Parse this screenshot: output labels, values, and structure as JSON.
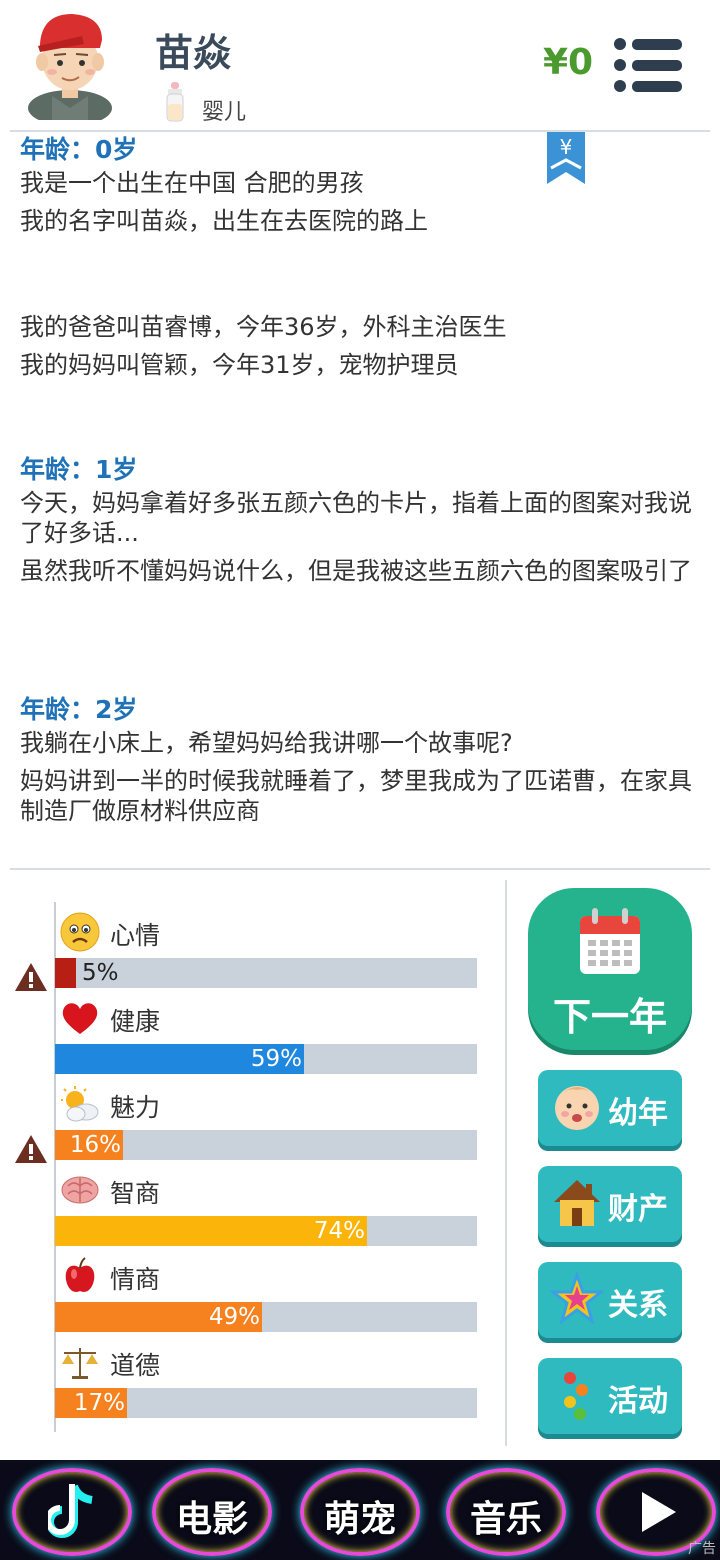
{
  "header": {
    "name": "苗焱",
    "stage": "婴儿",
    "money": "¥0",
    "bookmark_symbol": "¥"
  },
  "story": [
    {
      "age": "年龄：0岁",
      "lines": [
        "我是一个出生在中国 合肥的男孩",
        "我的名字叫苗焱，出生在去医院的路上"
      ]
    },
    {
      "age": "",
      "lines": [
        "我的爸爸叫苗睿博，今年36岁，外科主治医生",
        "我的妈妈叫管颖，今年31岁，宠物护理员"
      ]
    },
    {
      "age": "年龄：1岁",
      "lines": [
        "今天，妈妈拿着好多张五颜六色的卡片，指着上面的图案对我说了好多话...",
        "虽然我听不懂妈妈说什么，但是我被这些五颜六色的图案吸引了"
      ]
    },
    {
      "age": "年龄：2岁",
      "lines": [
        "我躺在小床上，希望妈妈给我讲哪一个故事呢?",
        "妈妈讲到一半的时候我就睡着了，梦里我成为了匹诺曹，在家具制造厂做原材料供应商"
      ]
    }
  ],
  "stats": [
    {
      "label": "心情",
      "value": 5,
      "text": "5%",
      "icon": "worried-face-icon",
      "color": "#b81f14",
      "warning": true
    },
    {
      "label": "健康",
      "value": 59,
      "text": "59%",
      "icon": "heart-icon",
      "color": "#1f87de",
      "warning": false
    },
    {
      "label": "魅力",
      "value": 16,
      "text": "16%",
      "icon": "sun-cloud-icon",
      "color": "#f5821f",
      "warning": true
    },
    {
      "label": "智商",
      "value": 74,
      "text": "74%",
      "icon": "brain-icon",
      "color": "#fbb40a",
      "warning": false
    },
    {
      "label": "情商",
      "value": 49,
      "text": "49%",
      "icon": "apple-icon",
      "color": "#f5821f",
      "warning": false
    },
    {
      "label": "道德",
      "value": 17,
      "text": "17%",
      "icon": "scales-icon",
      "color": "#f5821f",
      "warning": false
    }
  ],
  "buttons": {
    "next_year": "下一年",
    "childhood": "幼年",
    "assets": "财产",
    "relations": "关系",
    "activities": "活动"
  },
  "ad": {
    "items": [
      "",
      "电影",
      "萌宠",
      "音乐",
      ""
    ],
    "tag": "广告"
  }
}
